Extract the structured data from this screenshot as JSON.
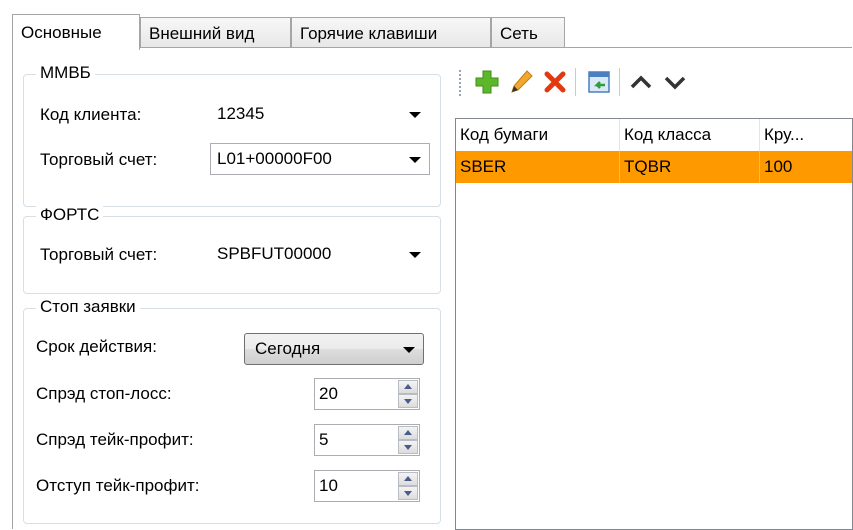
{
  "tabs": [
    {
      "label": "Основные",
      "active": true
    },
    {
      "label": "Внешний вид",
      "active": false
    },
    {
      "label": "Горячие клавиши",
      "active": false
    },
    {
      "label": "Сеть",
      "active": false
    }
  ],
  "mmvb": {
    "title": "ММВБ",
    "client_code_label": "Код клиента:",
    "client_code_value": "12345",
    "account_label": "Торговый счет:",
    "account_value": "L01+00000F00"
  },
  "forts": {
    "title": "ФОРТС",
    "account_label": "Торговый счет:",
    "account_value": "SPBFUT00000"
  },
  "stop_orders": {
    "title": "Стоп заявки",
    "expiry_label": "Срок действия:",
    "expiry_value": "Сегодня",
    "stop_loss_label": "Спрэд стоп-лосс:",
    "stop_loss_value": "20",
    "take_profit_label": "Спрэд тейк-профит:",
    "take_profit_value": "5",
    "offset_label": "Отступ тейк-профит:",
    "offset_value": "10"
  },
  "toolbar": {
    "icons": [
      "add-icon",
      "edit-icon",
      "delete-icon",
      "import-icon",
      "move-up-icon",
      "move-down-icon"
    ],
    "colors": {
      "add": "#5cb82a",
      "edit": "#f0a830",
      "delete": "#e23a10"
    }
  },
  "grid": {
    "columns": [
      "Код бумаги",
      "Код класса",
      "Кру..."
    ],
    "rows": [
      {
        "security": "SBER",
        "class": "TQBR",
        "lot": "100",
        "selected": true
      }
    ],
    "selected_color": "#ff9900"
  }
}
